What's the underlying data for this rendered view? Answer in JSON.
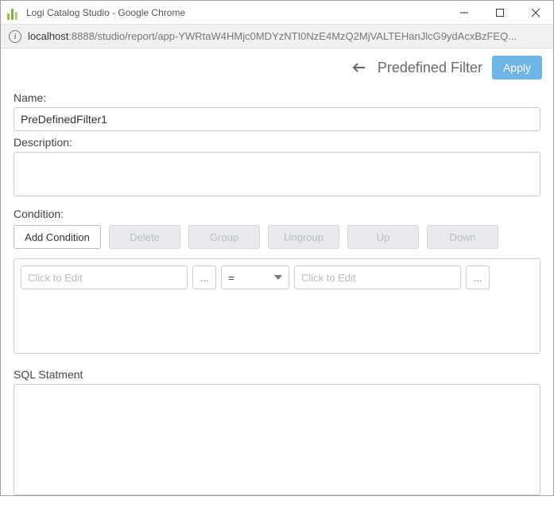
{
  "window": {
    "title": "Logi Catalog Studio - Google Chrome"
  },
  "url": {
    "host": "localhost",
    "path": ":8888/studio/report/app-YWRtaW4HMjc0MDYzNTI0NzE4MzQ2MjVALTEHanJlcG9ydAcxBzFEQ...",
    "info_glyph": "i"
  },
  "header": {
    "title": "Predefined Filter",
    "apply_label": "Apply"
  },
  "fields": {
    "name_label": "Name:",
    "name_value": "PreDefinedFilter1",
    "description_label": "Description:",
    "condition_label": "Condition:",
    "sql_label": "SQL Statment"
  },
  "buttons": {
    "add": "Add Condition",
    "delete": "Delete",
    "group": "Group",
    "ungroup": "Ungroup",
    "up": "Up",
    "down": "Down"
  },
  "condition_row": {
    "left_placeholder": "Click to Edit",
    "left_ellipsis": "...",
    "operator": "=",
    "right_placeholder": "Click to Edit",
    "right_ellipsis": "..."
  }
}
